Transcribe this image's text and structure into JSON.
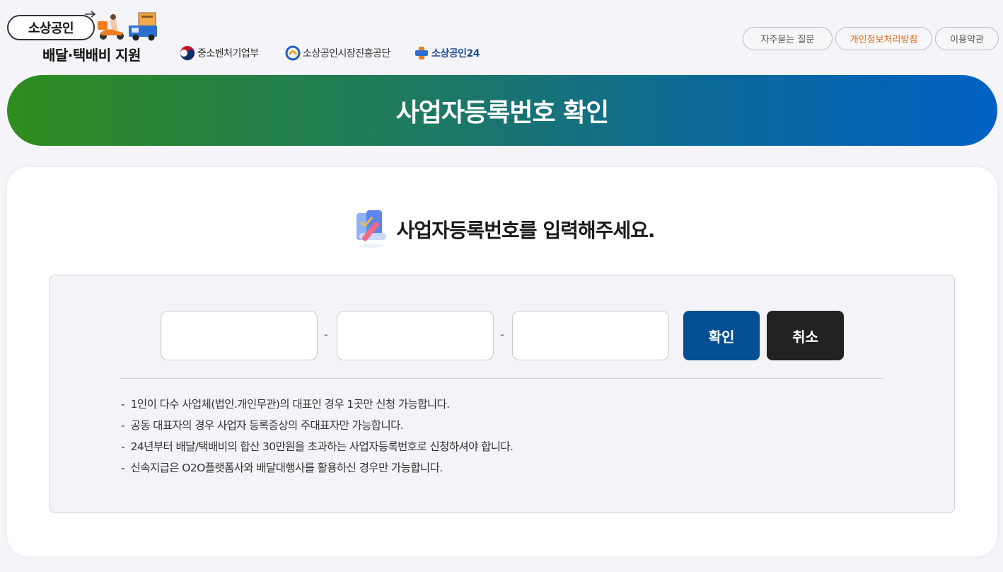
{
  "header": {
    "logo_main": "소상공인",
    "logo_sub": "배달·택배비 지원",
    "partners": [
      {
        "name": "중소벤처기업부"
      },
      {
        "name": "소상공인시장진흥공단"
      },
      {
        "name": "소상공인24"
      }
    ],
    "top_links": [
      {
        "label": "자주묻는 질문"
      },
      {
        "label": "개인정보처리방침"
      },
      {
        "label": "이용약관"
      }
    ]
  },
  "banner": {
    "title": "사업자등록번호 확인"
  },
  "main": {
    "heading": "사업자등록번호를 입력해주세요.",
    "inputs": [
      {
        "value": "",
        "placeholder": ""
      },
      {
        "value": "",
        "placeholder": ""
      },
      {
        "value": "",
        "placeholder": ""
      }
    ],
    "separator": "-",
    "confirm_label": "확인",
    "cancel_label": "취소",
    "notes": [
      "1인이 다수 사업체(법인.개인무관)의 대표인 경우 1곳만 신청 가능합니다.",
      "공동 대표자의 경우 사업자 등록증상의 주대표자만 가능합니다.",
      "24년부터 배달/택배비의 합산 30만원을 초과하는 사업자등록번호로 신청하셔야 합니다.",
      "신속지급은 O2O플랫폼사와 배달대행사를 활용하신 경우만 가능합니다."
    ]
  },
  "colors": {
    "banner_start": "#2f8c1e",
    "banner_end": "#0061c4",
    "confirm_button": "#044e94",
    "cancel_button": "#222222",
    "privacy_link": "#e06a1a"
  },
  "icons": [
    "delivery-scooter-icon",
    "delivery-truck-icon",
    "gov-emblem-icon",
    "semas-logo-icon",
    "sosang24-logo-icon",
    "document-pencil-icon"
  ]
}
